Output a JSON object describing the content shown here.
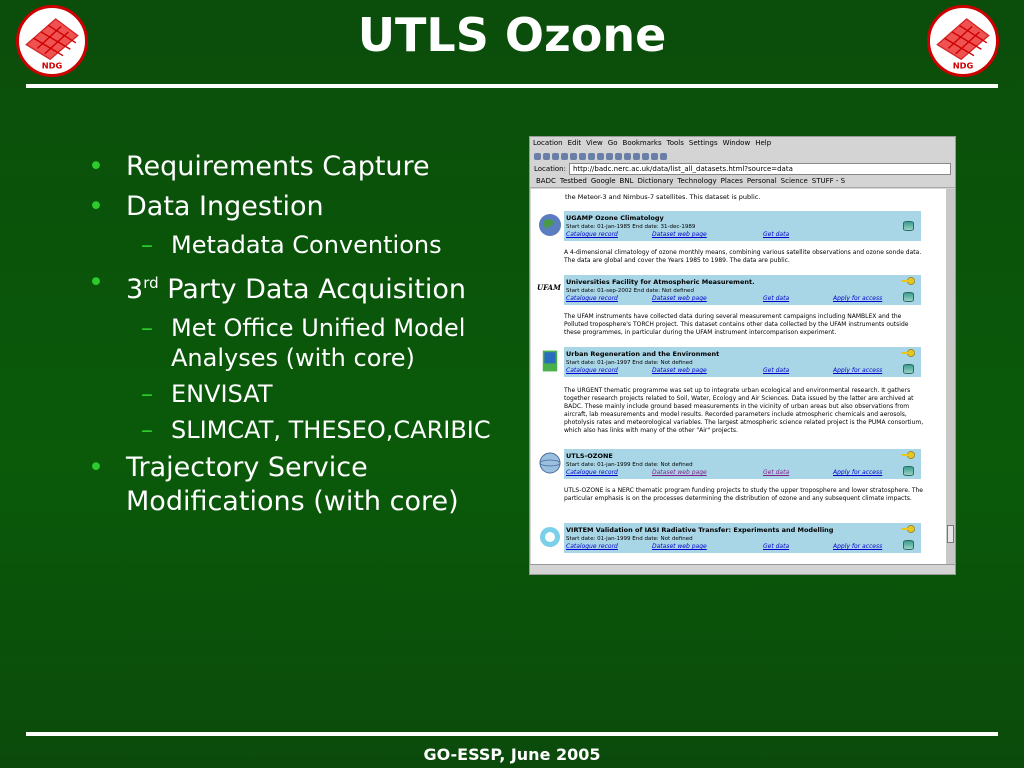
{
  "slide": {
    "title": "UTLS Ozone",
    "footer": "GO-ESSP, June 2005",
    "logo_text": "NDG",
    "bullets": {
      "b1": "Requirements Capture",
      "b2": "Data Ingestion",
      "b2_sub1": "Metadata Conventions",
      "b3_base": "3",
      "b3_sup": "rd",
      "b3_rest": " Party Data Acquisition",
      "b3_sub1": "Met Office Unified Model Analyses (with core)",
      "b3_sub2": "ENVISAT",
      "b3_sub3": "SLIMCAT, THESEO,CARIBIC",
      "b4": "Trajectory Service Modifications (with core)"
    },
    "accent_color": "#2bcc2b"
  },
  "browser": {
    "menu": [
      "Location",
      "Edit",
      "View",
      "Go",
      "Bookmarks",
      "Tools",
      "Settings",
      "Window",
      "Help"
    ],
    "location_label": "Location:",
    "url": "http://badc.nerc.ac.uk/data/list_all_datasets.html?source=data",
    "bookmarks": [
      "BADC",
      "Testbed",
      "Google",
      "BNL",
      "Dictionary",
      "Technology",
      "Places",
      "Personal",
      "Science",
      "STUFF - S"
    ],
    "intro_text": "the Meteor-3 and Nimbus-7 satellites. This dataset is public.",
    "datasets": [
      {
        "title": "UGAMP Ozone Climatology",
        "dates": "Start date: 01-jan-1985   End date: 31-dec-1989",
        "links": [
          "Catalogue record",
          "Dataset web page",
          "Get data"
        ],
        "description": "A 4-dimensional climatology of ozone monthly means, combining various satellite observations and ozone sonde data. The data are global and cover the Years 1985 to 1989. The data are public."
      },
      {
        "title": "Universities Facility for Atmospheric Measurement.",
        "icon_label": "UFAM",
        "dates": "Start date: 01-sep-2002   End date: Not defined",
        "links": [
          "Catalogue record",
          "Dataset web page",
          "Get data",
          "Apply for access"
        ],
        "description": "The UFAM instruments have collected data during several measurement campaigns including NAMBLEX and the Polluted troposphere's TORCH project. This dataset contains other data collected by the UFAM instruments outside these programmes, in particular during the UFAM instrument intercomparison experiment."
      },
      {
        "title": "Urban Regeneration and the Environment",
        "dates": "Start date: 01-jan-1997   End date: Not defined",
        "links": [
          "Catalogue record",
          "Dataset web page",
          "Get data",
          "Apply for access"
        ],
        "description": "The URGENT thematic programme was set up to integrate urban ecological and environmental research. It gathers together research projects related to Soil, Water, Ecology and Air Sciences. Data issued by the latter are archived at BADC. These mainly include ground based measurements in the vicinity of urban areas but also observations from aircraft, lab measurements and model results. Recorded parameters include atmospheric chemicals and aerosols, photolysis rates and meteorological variables. The largest atmospheric science related project is the PUMA consortium, which also has links with many of the other \"Air\" projects."
      },
      {
        "title": "UTLS-OZONE",
        "dates": "Start date: 01-jan-1999   End date: Not defined",
        "links": [
          "Catalogue record",
          "Dataset web page",
          "Get data",
          "Apply for access"
        ],
        "description": "UTLS-OZONE is a NERC thematic program funding projects to study the upper troposphere and lower stratosphere. The particular emphasis is on the processes determining the distribution of ozone and any subsequent climate impacts."
      },
      {
        "title": "VIRTEM Validation of IASI Radiative Transfer: Experiments and Modelling",
        "dates": "Start date: 01-jan-1999   End date: Not defined",
        "links": [
          "Catalogue record",
          "Dataset web page",
          "Get data",
          "Apply for access"
        ]
      }
    ]
  }
}
